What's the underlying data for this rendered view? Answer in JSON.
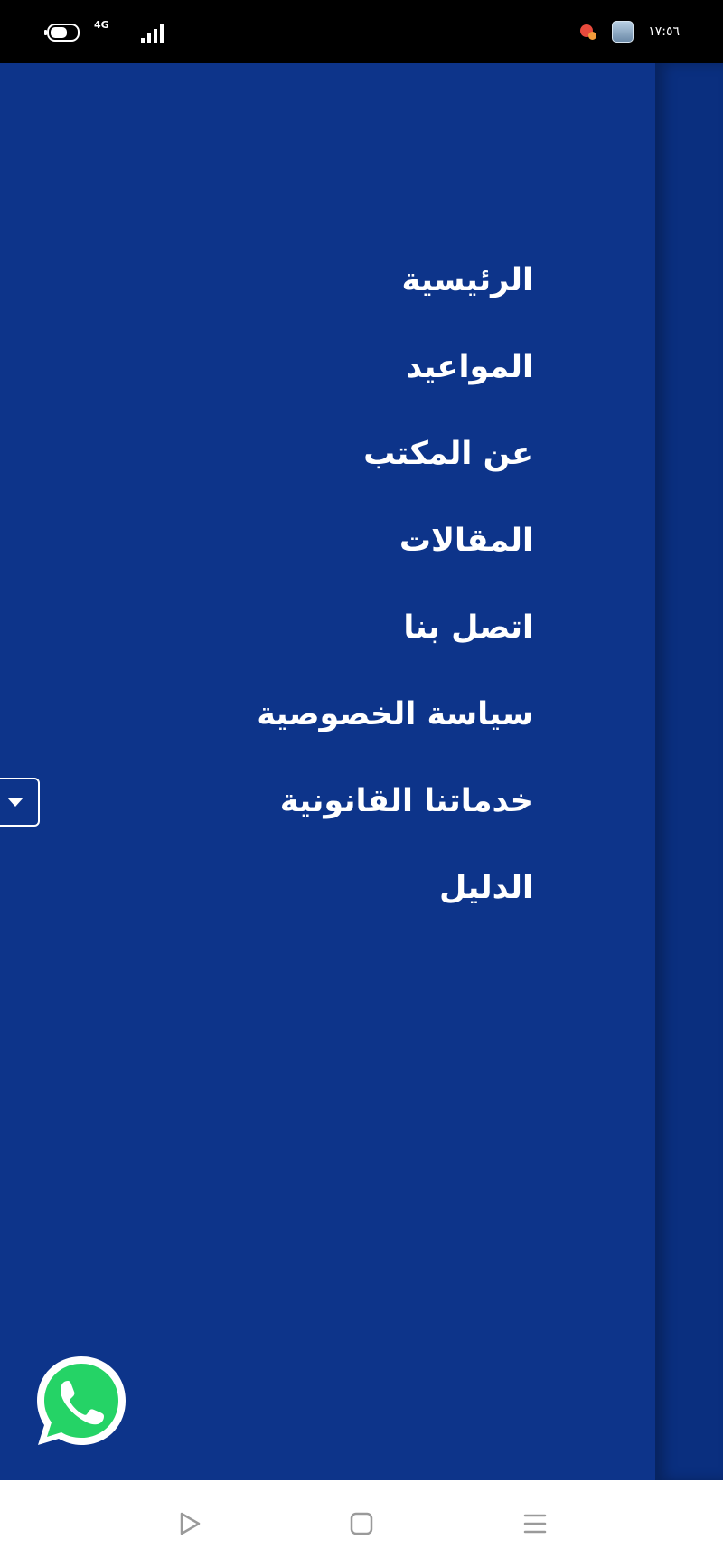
{
  "status_bar": {
    "network": "4G",
    "clock": "١٧:٥٦",
    "icons": [
      "battery-icon",
      "network-type-icon",
      "signal-icon",
      "alarm-icon",
      "app-notification-icon"
    ]
  },
  "menu": {
    "items": [
      {
        "label": "الرئيسية"
      },
      {
        "label": "المواعيد"
      },
      {
        "label": "عن المكتب"
      },
      {
        "label": "المقالات"
      },
      {
        "label": "اتصل بنا"
      },
      {
        "label": "سياسة الخصوصية"
      },
      {
        "label": "خدماتنا القانونية",
        "has_dropdown": true,
        "dropdown_icon": "caret-down-icon"
      },
      {
        "label": "الدليل"
      }
    ]
  },
  "floating_button": {
    "icon": "whatsapp-icon"
  },
  "nav_bar": {
    "buttons": [
      "back-icon",
      "home-icon",
      "menu-icon"
    ]
  },
  "colors": {
    "drawer_background": "#0d348a",
    "menu_text": "#ffffff",
    "whatsapp_green": "#25d366",
    "nav_icons": "#9a9a9a"
  }
}
